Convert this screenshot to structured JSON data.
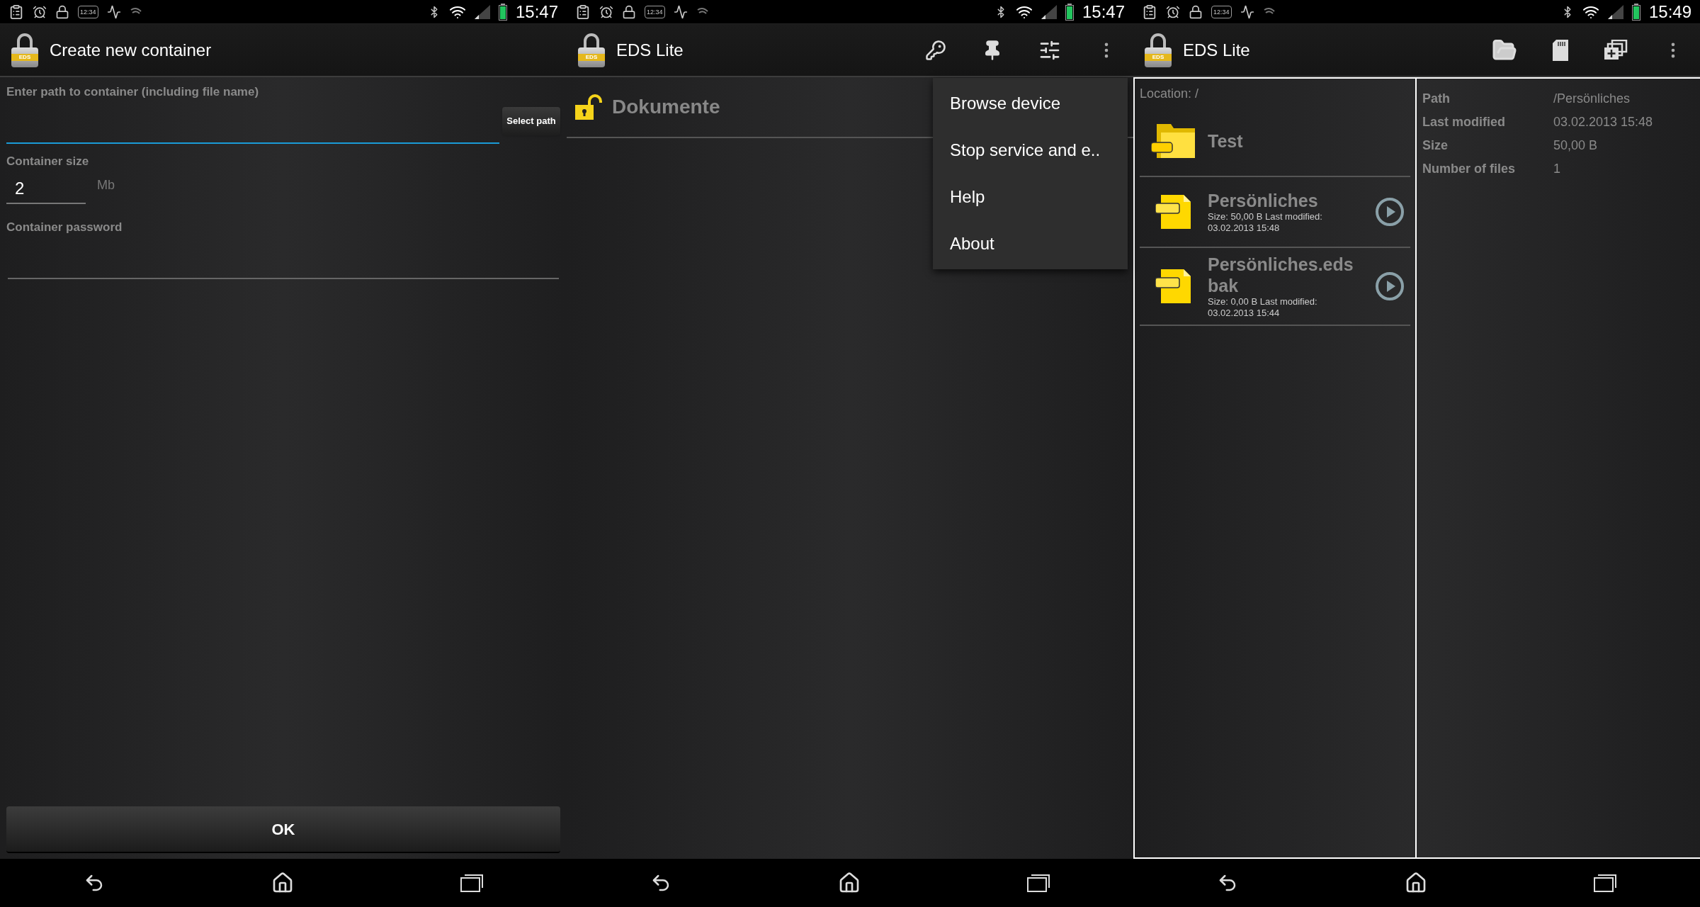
{
  "screens": [
    {
      "kind": "create",
      "status_bar": {
        "widget_text": "12:34",
        "time": "15:47"
      },
      "app_bar": {
        "logo_text": "EDS",
        "title": "Create new container"
      },
      "path_field": {
        "label": "Enter path to container (including file name)",
        "focused": true,
        "button": "Select path"
      },
      "size_field": {
        "label": "Container size",
        "value": "2",
        "unit": "Mb"
      },
      "password_field": {
        "label": "Container password"
      },
      "ok_button": "OK"
    },
    {
      "kind": "containers",
      "status_bar": {
        "widget_text": "12:34",
        "time": "15:47"
      },
      "app_bar": {
        "logo_text": "EDS",
        "title": "EDS Lite"
      },
      "containers": [
        {
          "name": "Dokumente",
          "locked": false
        }
      ],
      "menu": [
        "Browse device",
        "Stop service and e..",
        "Help",
        "About"
      ]
    },
    {
      "kind": "browser",
      "status_bar": {
        "widget_text": "12:34",
        "time": "15:49"
      },
      "app_bar": {
        "logo_text": "EDS",
        "title": "EDS Lite"
      },
      "location": "Location: /",
      "files": [
        {
          "kind": "folder",
          "name": "Test"
        },
        {
          "kind": "container",
          "name": "Persönliches",
          "info": "Size: 50,00 B Last modified: 03.02.2013 15:48"
        },
        {
          "kind": "container",
          "name": "Persönliches.edsbak",
          "info": "Size: 0,00 B Last modified: 03.02.2013 15:44"
        }
      ],
      "details": [
        {
          "label": "Path",
          "value": "/Persönliches"
        },
        {
          "label": "Last modified",
          "value": "03.02.2013 15:48"
        },
        {
          "label": "Size",
          "value": "50,00 B"
        },
        {
          "label": "Number of files",
          "value": "1"
        }
      ]
    }
  ]
}
